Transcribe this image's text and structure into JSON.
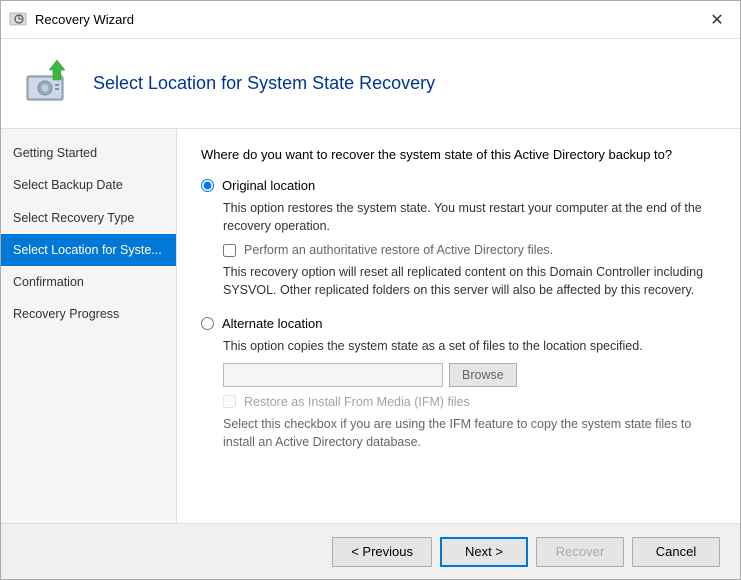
{
  "window": {
    "title": "Recovery Wizard",
    "close_label": "✕"
  },
  "header": {
    "title": "Select Location for System State Recovery"
  },
  "sidebar": {
    "items": [
      {
        "id": "getting-started",
        "label": "Getting Started",
        "active": false
      },
      {
        "id": "select-backup-date",
        "label": "Select Backup Date",
        "active": false
      },
      {
        "id": "select-recovery-type",
        "label": "Select Recovery Type",
        "active": false
      },
      {
        "id": "select-location",
        "label": "Select Location for Syste...",
        "active": true
      },
      {
        "id": "confirmation",
        "label": "Confirmation",
        "active": false
      },
      {
        "id": "recovery-progress",
        "label": "Recovery Progress",
        "active": false
      }
    ]
  },
  "main": {
    "question": "Where do you want to recover the system state of this Active Directory backup to?",
    "original_location_label": "Original location",
    "original_location_desc": "This option restores the system state. You must restart your computer at the end of the recovery operation.",
    "authoritative_checkbox_label": "Perform an authoritative restore of Active Directory files.",
    "authoritative_desc": "This recovery option will reset all replicated content on this Domain Controller including SYSVOL. Other replicated folders on this server will also be affected by this recovery.",
    "alternate_location_label": "Alternate location",
    "alternate_location_desc": "This option copies the system state as a set of files to the location specified.",
    "browse_label": "Browse",
    "ifm_checkbox_label": "Restore as Install From Media (IFM) files",
    "ifm_desc": "Select this checkbox if you are using the IFM feature to copy the system state files to install an Active Directory database."
  },
  "footer": {
    "previous_label": "< Previous",
    "next_label": "Next >",
    "recover_label": "Recover",
    "cancel_label": "Cancel"
  },
  "colors": {
    "active_sidebar": "#0078d7",
    "primary_button_border": "#0078d7"
  }
}
